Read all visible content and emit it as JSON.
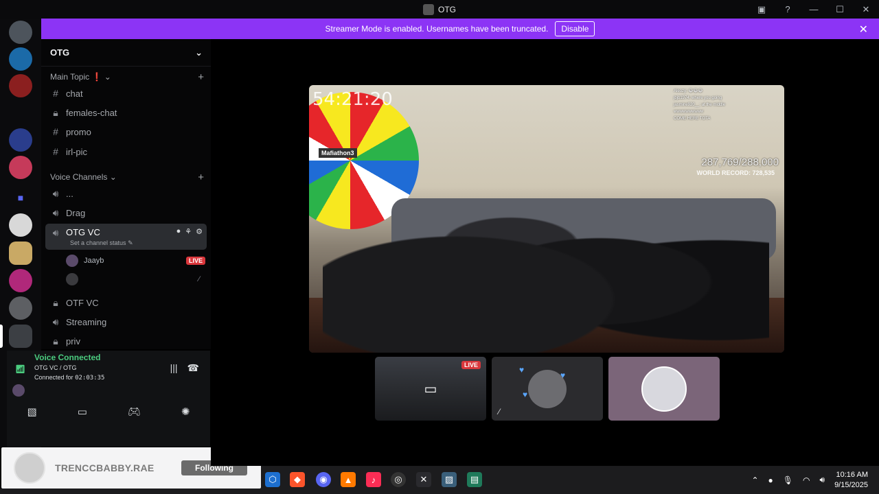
{
  "window": {
    "title": "OTG",
    "icons": [
      "inbox-icon",
      "help-icon",
      "minimize-icon",
      "maximize-icon",
      "close-icon"
    ]
  },
  "banner": {
    "message": "Streamer Mode is enabled. Usernames have been truncated.",
    "button": "Disable"
  },
  "guild": {
    "name": "OTG"
  },
  "categories": {
    "main": "Main Topic ❗",
    "voice": "Voice Channels"
  },
  "text_channels": [
    {
      "name": "chat",
      "icon": "hash"
    },
    {
      "name": "females-chat",
      "icon": "lock"
    },
    {
      "name": "promo",
      "icon": "hash"
    },
    {
      "name": "irl-pic",
      "icon": "hash"
    }
  ],
  "voice_channels": [
    {
      "name": "...",
      "icon": "speaker"
    },
    {
      "name": "Drag",
      "icon": "speaker"
    },
    {
      "name": "OTG VC",
      "icon": "speaker",
      "status": "Set a channel status",
      "users": [
        {
          "name": "Jaayb",
          "badge": "LIVE"
        },
        {
          "name": ""
        }
      ]
    },
    {
      "name": "OTF VC",
      "icon": "lock"
    },
    {
      "name": "Streaming",
      "icon": "speaker"
    },
    {
      "name": "priv",
      "icon": "lock"
    }
  ],
  "voice": {
    "status": "Voice Connected",
    "channel": "OTG VC / OTG",
    "connected_label": "Connected for",
    "duration": "02:03:35"
  },
  "stream": {
    "timer": "54:21:20",
    "counter": "287,769/288,000",
    "record": "WORLD RECORD: 728,535",
    "wheel_label": "Mafiathon3",
    "chat_lines": [
      "Aleozy: 😂😂😂",
      "jbjb1974: where you going",
      "jasmine920__: at the middle",
      "wwwwwwwwww",
      "COME HERE TOTA"
    ]
  },
  "tiles": [
    {
      "badge": "LIVE"
    }
  ],
  "follow_card": {
    "name": "TRENCCBABBY.RAE",
    "button": "Following"
  },
  "taskbar": {
    "time": "10:16 AM",
    "date": "9/15/2025"
  },
  "colors": {
    "banner": "#8c34f5",
    "live": "#da373c",
    "voice_green": "#4bcc7f"
  }
}
